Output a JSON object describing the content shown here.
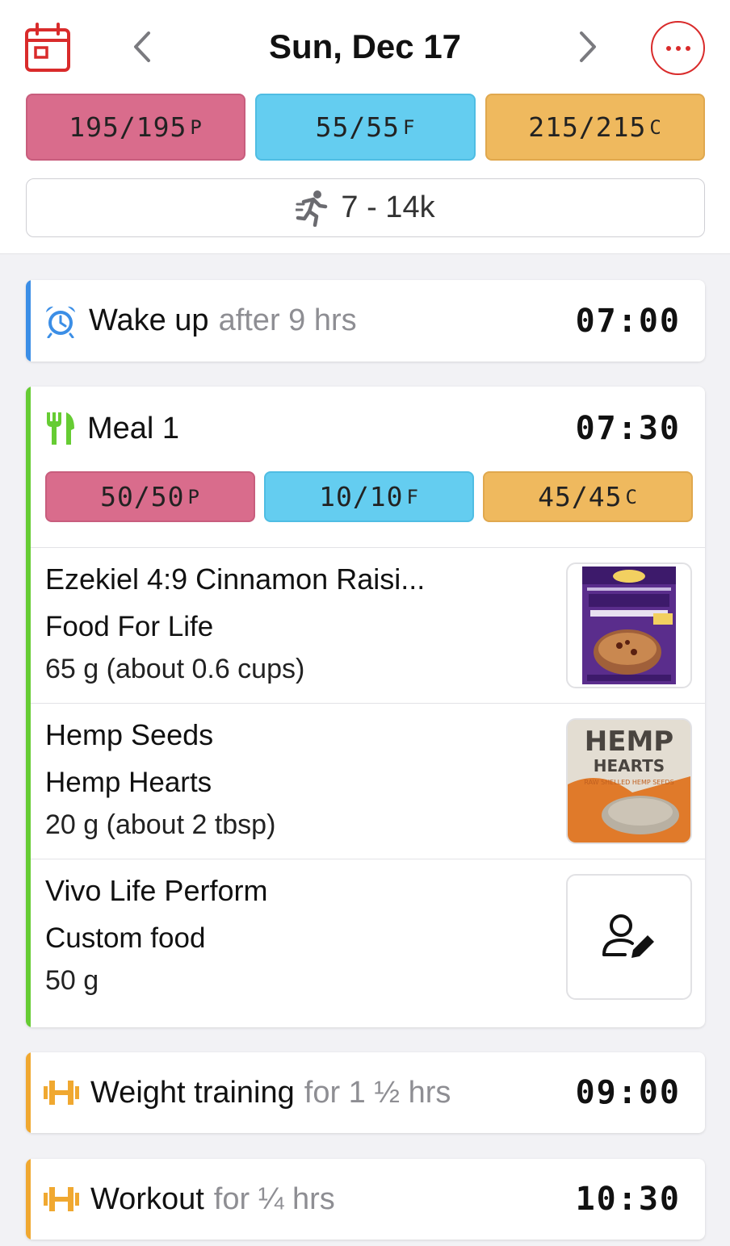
{
  "header": {
    "date": "Sun, Dec 17",
    "targets": [
      {
        "value": "195/195",
        "unit": "P",
        "color": "#d96c8c"
      },
      {
        "value": "55/55",
        "unit": "F",
        "color": "#64cdf0"
      },
      {
        "value": "215/215",
        "unit": "C",
        "color": "#efb95e"
      }
    ],
    "steps": "7 - 14k",
    "icons": {
      "calendar": "calendar-icon",
      "prev": "chevron-left-icon",
      "next": "chevron-right-icon",
      "more": "ellipsis-icon",
      "steps": "running-person-icon"
    },
    "accent": "#d92b2b"
  },
  "wake": {
    "title": "Wake up",
    "sub": "after 9 hrs",
    "time": "07:00",
    "bar_color": "#3b8ee6",
    "icon": "alarm-clock-icon"
  },
  "meal": {
    "title": "Meal 1",
    "time": "07:30",
    "bar_color": "#66cc33",
    "icon": "fork-knife-icon",
    "macros": [
      {
        "value": "50/50",
        "unit": "P"
      },
      {
        "value": "10/10",
        "unit": "F"
      },
      {
        "value": "45/45",
        "unit": "C"
      }
    ],
    "foods": [
      {
        "name": "Ezekiel 4:9 Cinnamon Raisi...",
        "brand": "Food For Life",
        "qty": "65 g (about 0.6 cups)",
        "image": "cereal-box-image"
      },
      {
        "name": "Hemp Seeds",
        "brand": "Hemp Hearts",
        "qty": "20 g (about 2 tbsp)",
        "image": "hemp-hearts-image",
        "image_text": [
          "HEMP",
          "HEARTS",
          "RAW SHELLED HEMP SEEDS"
        ]
      },
      {
        "name": "Vivo Life Perform",
        "brand": "Custom food",
        "qty": "50 g",
        "image": "user-edit-icon"
      }
    ]
  },
  "weight": {
    "title": "Weight training",
    "sub": "for 1 ½ hrs",
    "time": "09:00",
    "bar_color": "#f0a830",
    "icon": "dumbbell-icon"
  },
  "workout": {
    "title": "Workout",
    "sub": "for ¼ hrs",
    "time": "10:30",
    "bar_color": "#f0a830",
    "icon": "dumbbell-icon"
  }
}
